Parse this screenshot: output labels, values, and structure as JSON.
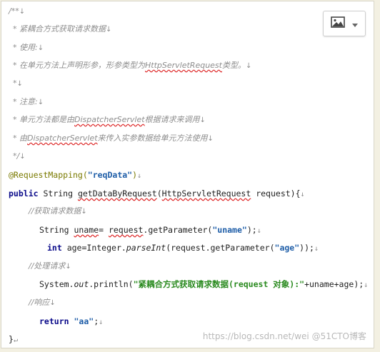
{
  "code": {
    "c_open": "/**",
    "c1": "* 紧耦合方式获取请求数据",
    "c2": "* 使用:",
    "c3": "* 在单元方法上声明形参，形参类型为",
    "c3_type": "HttpServletRequest",
    "c3_end": "类型。",
    "c4": "*",
    "c5": "* 注意:",
    "c6a": "* 单元方法都是由",
    "c6_ds": "DispatcherServlet",
    "c6b": "根据请求来调用",
    "c7a": "* 由",
    "c7_ds": "DispatcherServlet",
    "c7b": "来传入实参数据给单元方法使用",
    "c_close": "*/",
    "annotation": "@RequestMapping(",
    "annotation_arg": "\"reqData\"",
    "annotation_end": ")",
    "sig_kw": "public",
    "sig_rest_a": " String ",
    "sig_method": "getDataByRequest",
    "sig_rest_b": "(",
    "sig_param_type": "HttpServletRequest",
    "sig_rest_c": " request){",
    "cm_get": "//获取请求数据",
    "l_uname_a": "String ",
    "l_uname_var": "uname",
    "l_uname_b": "= ",
    "l_uname_req": "request",
    "l_uname_c": ".getParameter(",
    "l_uname_str": "\"uname\"",
    "l_uname_d": ");",
    "l_age_kw": "int",
    "l_age_a": " age=Integer.",
    "l_age_parse": "parseInt",
    "l_age_b": "(request.getParameter(",
    "l_age_str": "\"age\"",
    "l_age_c": "));",
    "cm_proc": "//处理请求",
    "l_sys_a": "System.",
    "l_sys_out": "out",
    "l_sys_b": ".println(",
    "l_sys_str": "\"紧耦合方式获取请求数据(request 对象):\"",
    "l_sys_c": "+uname+age);",
    "cm_resp": "//响应",
    "l_ret_kw": "return",
    "l_ret_str": "\"aa\"",
    "l_ret_end": ";",
    "close": "}"
  },
  "toolbar": {
    "image_icon": "image-icon",
    "dropdown_icon": "chevron-down-icon"
  },
  "watermark": "https://blog.csdn.net/wei @51CTO博客",
  "marks": {
    "para": "↓",
    "enter": "↵"
  }
}
